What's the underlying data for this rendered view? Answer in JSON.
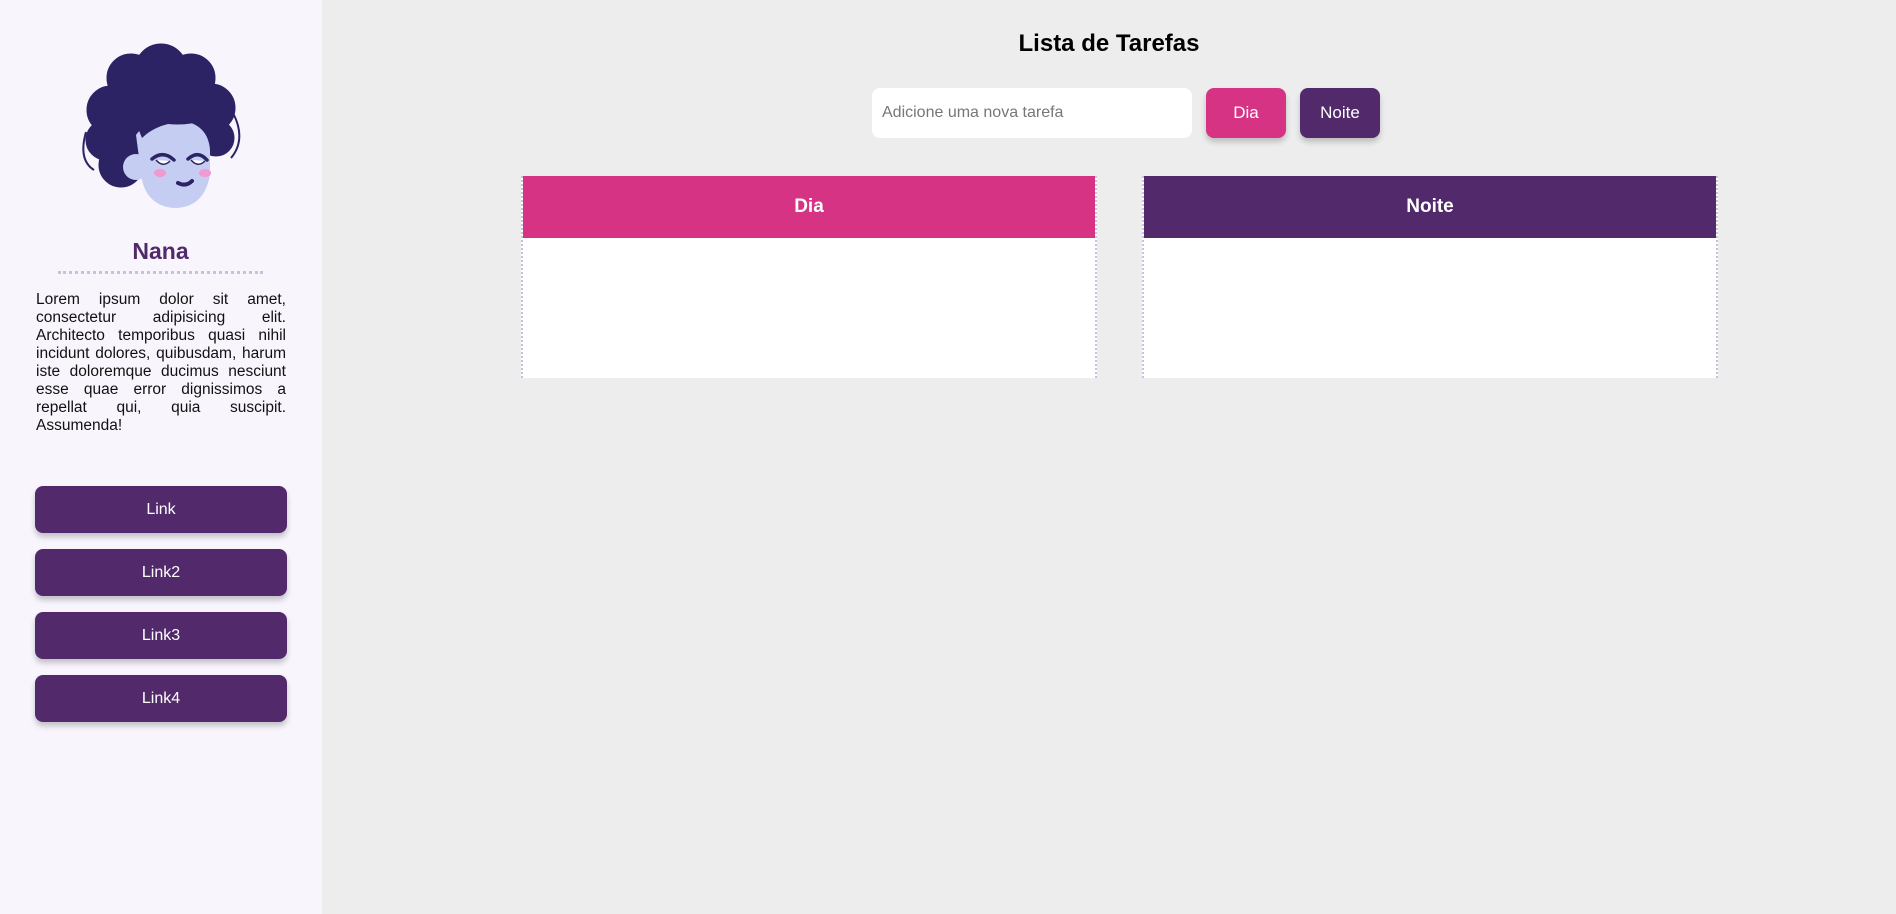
{
  "sidebar": {
    "name": "Nana",
    "bio": "Lorem ipsum dolor sit amet, consectetur adipisicing elit. Architecto temporibus quasi nihil incidunt dolores, quibusdam, harum iste doloremque ducimus nesciunt esse quae error dignissimos a repellat qui, quia suscipit. Assumenda!",
    "links": [
      "Link",
      "Link2",
      "Link3",
      "Link4"
    ]
  },
  "main": {
    "title": "Lista de Tarefas",
    "input_placeholder": "Adicione uma nova tarefa",
    "buttons": {
      "dia": "Dia",
      "noite": "Noite"
    },
    "columns": {
      "dia": "Dia",
      "noite": "Noite"
    }
  },
  "colors": {
    "sidebar_bg": "#f8f5fd",
    "main_bg": "#ededed",
    "pink": "#d63384",
    "purple": "#522a6b",
    "hair": "#2c2364",
    "skin": "#c5cdf2"
  }
}
